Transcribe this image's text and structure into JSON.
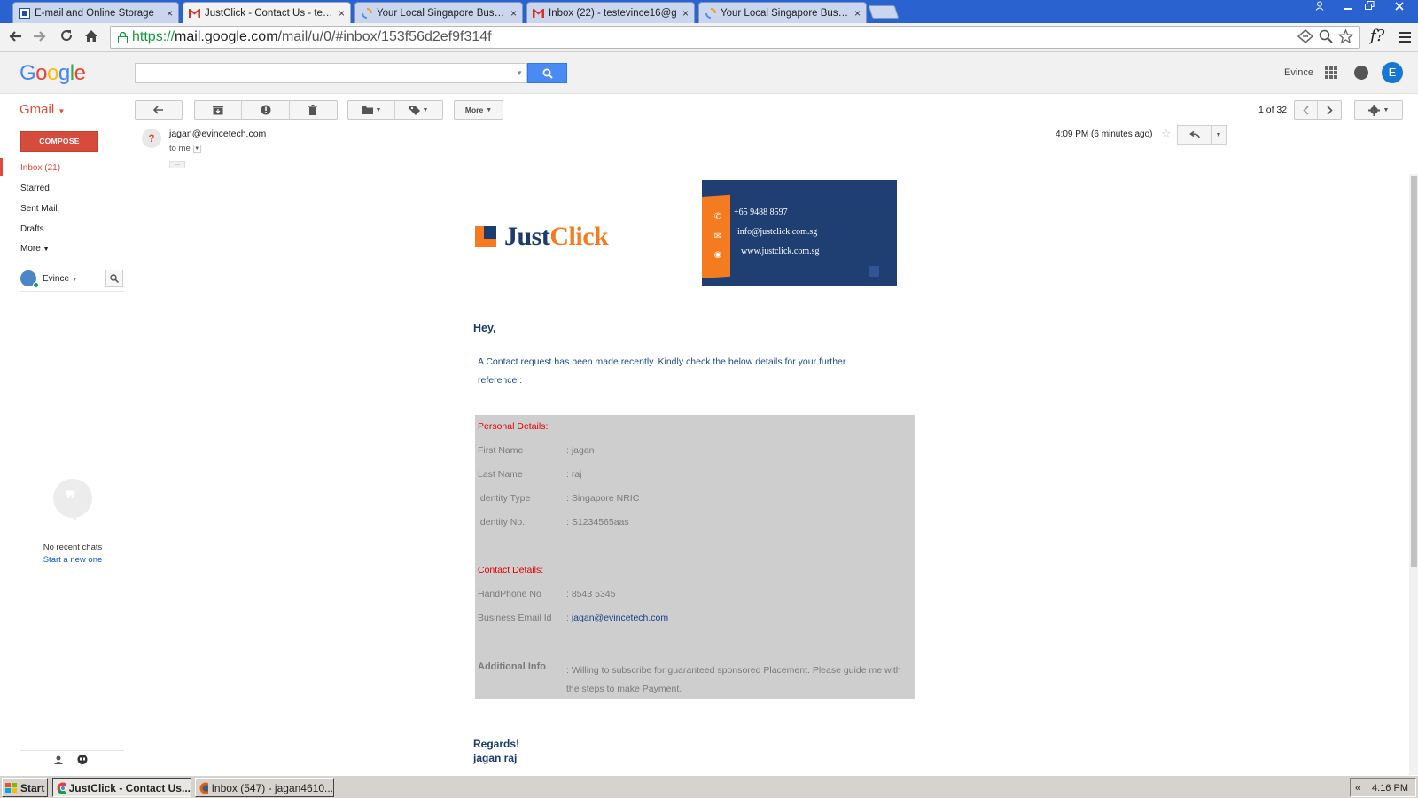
{
  "browser": {
    "tabs": [
      {
        "title": "E-mail and Online Storage",
        "favicon": "webmail-icon"
      },
      {
        "title": "JustClick - Contact Us - teste",
        "favicon": "gmail-icon",
        "active": true
      },
      {
        "title": "Your Local Singapore Busines",
        "favicon": "loading-icon"
      },
      {
        "title": "Inbox (22) - testevince16@g",
        "favicon": "gmail-icon"
      },
      {
        "title": "Your Local Singapore Busines",
        "favicon": "loading-icon"
      }
    ],
    "close_glyph": "×",
    "url": {
      "scheme": "https://",
      "host": "mail.google.com",
      "path": "/mail/u/0/#inbox/153f56d2ef9f314f"
    },
    "extension_label": "f?"
  },
  "gmail": {
    "logo": [
      "G",
      "o",
      "o",
      "g",
      "l",
      "e"
    ],
    "logo_colors": [
      "#4285f4",
      "#ea4335",
      "#fbbc05",
      "#4285f4",
      "#34a853",
      "#ea4335"
    ],
    "search": {
      "placeholder": "",
      "value": ""
    },
    "header_user": "Evince",
    "avatar_letter": "E",
    "app_label": "Gmail",
    "toolbar": {
      "more_label": "More"
    },
    "pager": "1 of 32",
    "nav": {
      "compose_label": "COMPOSE",
      "items": [
        {
          "label": "Inbox (21)"
        },
        {
          "label": "Starred"
        },
        {
          "label": "Sent Mail"
        },
        {
          "label": "Drafts"
        },
        {
          "label": "More"
        }
      ],
      "hangouts_user": "Evince",
      "no_recent_chats": "No recent chats",
      "start_new": "Start a new one"
    },
    "accent_color": "#dd4b39",
    "link_color": "#1155cc"
  },
  "message": {
    "sender_initial": "?",
    "sender": "jagan@evincetech.com",
    "to": "to me",
    "time": "4:09 PM (6 minutes ago)"
  },
  "email": {
    "brand": {
      "just": "Just",
      "click": "Click",
      "orange": "#f47b20",
      "navy": "#1d3c6e"
    },
    "card": {
      "phone": "+65 9488 8597",
      "email": "info@justclick.com.sg",
      "web": "www.justclick.com.sg"
    },
    "greeting": "Hey,",
    "intro": "A Contact request has been made recently. Kindly check the below details for your further reference :",
    "personal_heading": "Personal Details:",
    "personal": [
      {
        "label": "First Name",
        "value": ": jagan"
      },
      {
        "label": "Last Name",
        "value": ": raj"
      },
      {
        "label": "Identity Type",
        "value": ": Singapore NRIC"
      },
      {
        "label": "Identity No.",
        "value": ": S1234565aas"
      }
    ],
    "contact_heading": "Contact Details:",
    "contact": [
      {
        "label": "HandPhone No",
        "value": ": 8543 5345"
      },
      {
        "label": "Business Email Id",
        "value_prefix": ": ",
        "value": "jagan@evincetech.com"
      }
    ],
    "additional_label": "Additional Info",
    "additional_value": ": Willing to subscribe for guaranteed sponsored Placement. Please guide me with the steps to make Payment.",
    "regards": "Regards!",
    "signature": "jagan raj"
  },
  "taskbar": {
    "start_label": "Start",
    "tasks": [
      {
        "label": "JustClick - Contact Us...",
        "active": true
      },
      {
        "label": "Inbox (547) - jagan4610..."
      }
    ],
    "tray_chevron": "«",
    "clock": "4:16 PM"
  }
}
